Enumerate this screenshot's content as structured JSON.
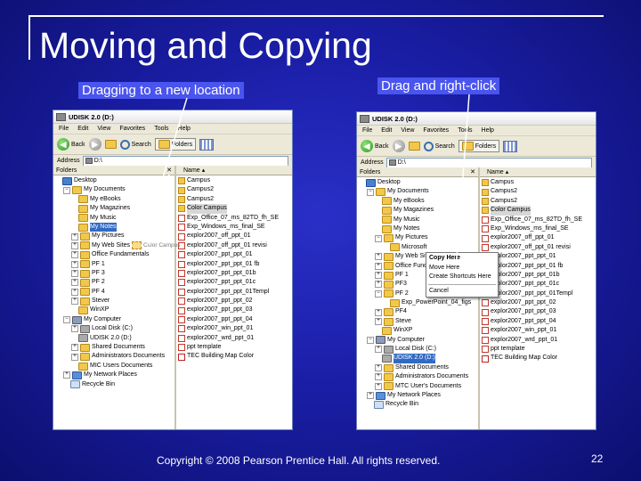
{
  "slide": {
    "title": "Moving and Copying",
    "label_left": "Dragging to a new location",
    "label_right": "Drag and right-click",
    "footer": "Copyright © 2008 Pearson Prentice Hall. All rights reserved.",
    "page_number": "22"
  },
  "colors": {
    "background": "#1a1ea6",
    "label_bg": "#4a54ee",
    "selection": "#316ac5"
  },
  "left_window": {
    "title": "UDISK 2.0 (D:)",
    "menu": [
      "File",
      "Edit",
      "View",
      "Favorites",
      "Tools",
      "Help"
    ],
    "back": "Back",
    "search": "Search",
    "folders": "Folders",
    "address_label": "Address",
    "address_value": "D:\\",
    "folders_pane_title": "Folders",
    "list_header": "Name",
    "ghost_label": "Color Campus",
    "tree": [
      {
        "label": "Desktop",
        "exp": "",
        "icon": "desktop",
        "indent": 0
      },
      {
        "label": "My Documents",
        "exp": "−",
        "icon": "folder",
        "indent": 1
      },
      {
        "label": "My eBooks",
        "exp": "",
        "icon": "folder",
        "indent": 2
      },
      {
        "label": "My Magazines",
        "exp": "",
        "icon": "folder",
        "indent": 2
      },
      {
        "label": "My Music",
        "exp": "",
        "icon": "folder",
        "indent": 2
      },
      {
        "label": "My Notes",
        "exp": "",
        "icon": "folder",
        "indent": 2,
        "selected": true
      },
      {
        "label": "My Pictures",
        "exp": "+",
        "icon": "folder",
        "indent": 2
      },
      {
        "label": "My Web Sites",
        "exp": "+",
        "icon": "folder",
        "indent": 2
      },
      {
        "label": "Office Fundamentals",
        "exp": "+",
        "icon": "folder",
        "indent": 2
      },
      {
        "label": "PF 1",
        "exp": "+",
        "icon": "folder",
        "indent": 2
      },
      {
        "label": "PF 3",
        "exp": "+",
        "icon": "folder",
        "indent": 2
      },
      {
        "label": "PF 2",
        "exp": "+",
        "icon": "folder",
        "indent": 2
      },
      {
        "label": "PF 4",
        "exp": "+",
        "icon": "folder",
        "indent": 2
      },
      {
        "label": "Stever",
        "exp": "+",
        "icon": "folder",
        "indent": 2
      },
      {
        "label": "WinXP",
        "exp": "",
        "icon": "folder",
        "indent": 2
      },
      {
        "label": "My Computer",
        "exp": "−",
        "icon": "computer",
        "indent": 1
      },
      {
        "label": "Local Disk (C:)",
        "exp": "+",
        "icon": "drive",
        "indent": 2
      },
      {
        "label": "UDISK 2.0 (D:)",
        "exp": "",
        "icon": "drive",
        "indent": 2
      },
      {
        "label": "Shared Documents",
        "exp": "+",
        "icon": "folder",
        "indent": 2
      },
      {
        "label": "Administrators Documents",
        "exp": "+",
        "icon": "folder",
        "indent": 2
      },
      {
        "label": "MIC Users Documents",
        "exp": "",
        "icon": "folder",
        "indent": 2
      },
      {
        "label": "My Network Places",
        "exp": "+",
        "icon": "net",
        "indent": 1
      },
      {
        "label": "Recycle Bin",
        "exp": "",
        "icon": "bin",
        "indent": 1
      }
    ],
    "files": [
      {
        "name": "Campus",
        "type": "folder"
      },
      {
        "name": "Campus2",
        "type": "folder"
      },
      {
        "name": "Campus2",
        "type": "folder"
      },
      {
        "name": "Color Campus",
        "type": "folder",
        "highlight": true
      },
      {
        "name": "Exp_Office_07_ms_82TD_fh_SE",
        "type": "file"
      },
      {
        "name": "Exp_Windows_ms_final_SE",
        "type": "file"
      },
      {
        "name": "explor2007_off_ppt_01",
        "type": "file"
      },
      {
        "name": "explor2007_off_ppt_01 revisi",
        "type": "file"
      },
      {
        "name": "explor2007_ppt_ppt_01",
        "type": "file"
      },
      {
        "name": "explor2007_ppt_ppt_01 fb",
        "type": "file"
      },
      {
        "name": "explor2007_ppt_ppt_01b",
        "type": "file"
      },
      {
        "name": "explor2007_ppt_ppt_01c",
        "type": "file"
      },
      {
        "name": "explor2007_ppt_ppt_01Templ",
        "type": "file"
      },
      {
        "name": "explor2007_ppt_ppt_02",
        "type": "file"
      },
      {
        "name": "explor2007_ppt_ppt_03",
        "type": "file"
      },
      {
        "name": "explor2007_ppt_ppt_04",
        "type": "file"
      },
      {
        "name": "explor2007_win_ppt_01",
        "type": "file"
      },
      {
        "name": "explor2007_wrd_ppt_01",
        "type": "file"
      },
      {
        "name": "ppt template",
        "type": "file"
      },
      {
        "name": "TEC Building Map Color",
        "type": "pdf"
      }
    ]
  },
  "right_window": {
    "title": "UDISK 2.0 (D:)",
    "menu": [
      "File",
      "Edit",
      "View",
      "Favorites",
      "Tools",
      "Help"
    ],
    "back": "Back",
    "search": "Search",
    "folders": "Folders",
    "address_label": "Address",
    "address_value": "D:\\",
    "folders_pane_title": "Folders",
    "list_header": "Name",
    "tree": [
      {
        "label": "Desktop",
        "exp": "",
        "icon": "desktop",
        "indent": 0
      },
      {
        "label": "My Documents",
        "exp": "−",
        "icon": "folder",
        "indent": 1
      },
      {
        "label": "My eBooks",
        "exp": "",
        "icon": "folder",
        "indent": 2
      },
      {
        "label": "My Magazines",
        "exp": "",
        "icon": "folder",
        "indent": 2
      },
      {
        "label": "My Music",
        "exp": "",
        "icon": "folder",
        "indent": 2
      },
      {
        "label": "My Notes",
        "exp": "",
        "icon": "folder",
        "indent": 2
      },
      {
        "label": "My Pictures",
        "exp": "−",
        "icon": "folder",
        "indent": 2
      },
      {
        "label": "Microsoft",
        "exp": "",
        "icon": "folder",
        "indent": 3
      },
      {
        "label": "My Web Sites",
        "exp": "+",
        "icon": "folder",
        "indent": 2
      },
      {
        "label": "Office Fund",
        "exp": "+",
        "icon": "folder",
        "indent": 2
      },
      {
        "label": "PF 1",
        "exp": "+",
        "icon": "folder",
        "indent": 2
      },
      {
        "label": "PF3",
        "exp": "+",
        "icon": "folder",
        "indent": 2
      },
      {
        "label": "PF 2",
        "exp": "−",
        "icon": "folder",
        "indent": 2
      },
      {
        "label": "Exp_PowerPoint_04_figs",
        "exp": "",
        "icon": "folder",
        "indent": 3
      },
      {
        "label": "PF4",
        "exp": "+",
        "icon": "folder",
        "indent": 2
      },
      {
        "label": "Steve",
        "exp": "+",
        "icon": "folder",
        "indent": 2
      },
      {
        "label": "WinXP",
        "exp": "",
        "icon": "folder",
        "indent": 2
      },
      {
        "label": "My Computer",
        "exp": "−",
        "icon": "computer",
        "indent": 1
      },
      {
        "label": "Local Disk (C:)",
        "exp": "+",
        "icon": "drive",
        "indent": 2
      },
      {
        "label": "UDISK 2.0 (D:)",
        "exp": "",
        "icon": "drive",
        "indent": 2,
        "selected": true
      },
      {
        "label": "Shared Documents",
        "exp": "+",
        "icon": "folder",
        "indent": 2
      },
      {
        "label": "Administrators Documents",
        "exp": "+",
        "icon": "folder",
        "indent": 2
      },
      {
        "label": "MTC User's Documents",
        "exp": "+",
        "icon": "folder",
        "indent": 2
      },
      {
        "label": "My Network Places",
        "exp": "+",
        "icon": "net",
        "indent": 1
      },
      {
        "label": "Recycle Bin",
        "exp": "",
        "icon": "bin",
        "indent": 1
      }
    ],
    "files": [
      {
        "name": "Campus",
        "type": "folder"
      },
      {
        "name": "Campus2",
        "type": "folder"
      },
      {
        "name": "Campus2",
        "type": "folder"
      },
      {
        "name": "Color Campus",
        "type": "folder",
        "highlight": true
      },
      {
        "name": "Exp_Office_07_ms_82TD_fh_SE",
        "type": "file"
      },
      {
        "name": "Exp_Windows_ms_final_SE",
        "type": "file"
      },
      {
        "name": "explor2007_off_ppt_01",
        "type": "file"
      },
      {
        "name": "explor2007_off_ppt_01 revisi",
        "type": "file"
      },
      {
        "name": "explor2007_ppt_ppt_01",
        "type": "file"
      },
      {
        "name": "explor2007_ppt_ppt_01 fb",
        "type": "file"
      },
      {
        "name": "explor2007_ppt_ppt_01b",
        "type": "file"
      },
      {
        "name": "explor2007_ppt_ppt_01c",
        "type": "file"
      },
      {
        "name": "explor2007_ppt_ppt_01Templ",
        "type": "file"
      },
      {
        "name": "explor2007_ppt_ppt_02",
        "type": "file"
      },
      {
        "name": "explor2007_ppt_ppt_03",
        "type": "file"
      },
      {
        "name": "explor2007_ppt_ppt_04",
        "type": "file"
      },
      {
        "name": "explor2007_win_ppt_01",
        "type": "file"
      },
      {
        "name": "explor2007_wrd_ppt_01",
        "type": "file"
      },
      {
        "name": "ppt template",
        "type": "file"
      },
      {
        "name": "TEC Building Map Color",
        "type": "pdf"
      }
    ],
    "context_menu": [
      "Copy Here",
      "Move Here",
      "Create Shortcuts Here",
      "Cancel"
    ]
  }
}
